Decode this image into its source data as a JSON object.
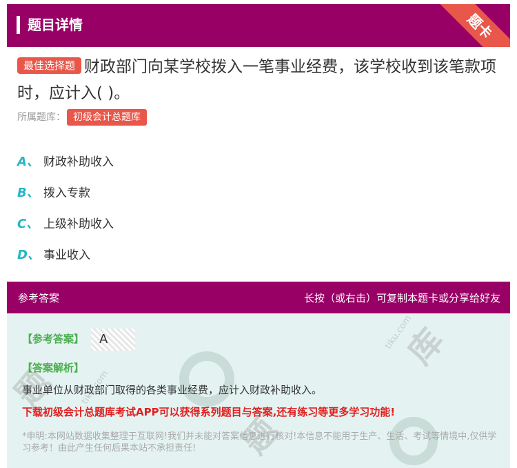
{
  "header": {
    "title": "题目详情",
    "ribbon": "题卡"
  },
  "question": {
    "type_tag": "最佳选择题",
    "text": "财政部门向某学校拨入一笔事业经费，该学校收到该笔款项时，应计入( )。",
    "bank_label": "所属题库：",
    "bank_name": "初级会计总题库"
  },
  "options": [
    {
      "letter": "A、",
      "text": "财政补助收入"
    },
    {
      "letter": "B、",
      "text": "拨入专款"
    },
    {
      "letter": "C、",
      "text": "上级补助收入"
    },
    {
      "letter": "D、",
      "text": "事业收入"
    }
  ],
  "answer_header": {
    "left": "参考答案",
    "right": "长按（或右击）可复制本题卡或分享给好友"
  },
  "answer": {
    "label": "【参考答案】",
    "value": "A",
    "analysis_label": "【答案解析】",
    "analysis": "事业单位从财政部门取得的各类事业经费，应计入财政补助收入。",
    "promo": "下载初级会计总题库考试APP可以获得系列题目与答案,还有练习等更多学习功能!",
    "disclaimer": "*申明:本网站数据收集整理于互联网!我们并未能对答案信息进行核对!本信息不能用于生产、生活、考试等情境中,仅供学习参考！由此产生任何后果本站不承担责任!"
  },
  "colors": {
    "header": "#990066",
    "accent": "#e8574a",
    "option_letter": "#25b7c4",
    "answer_label": "#4caf50",
    "promo": "#e02020"
  }
}
